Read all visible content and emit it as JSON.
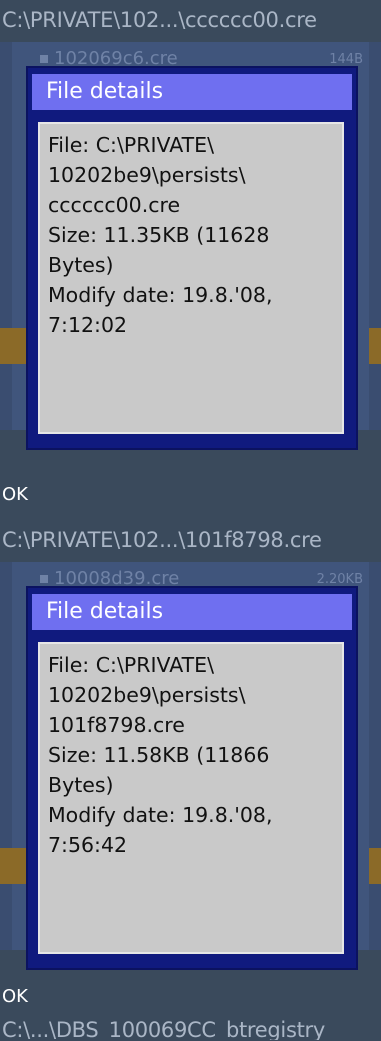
{
  "screens": [
    {
      "path": "C:\\PRIVATE\\102...\\cccccc00.cre",
      "background_file": "102069c6.cre",
      "background_size": "144B",
      "dialog": {
        "title": "File details",
        "lines": [
          "File: C:\\PRIVATE\\",
          "10202be9\\persists\\",
          "cccccc00.cre",
          "Size: 11.35KB (11628",
          "Bytes)",
          "Modify date: 19.8.'08,",
          "7:12:02"
        ]
      },
      "softkey": "OK"
    },
    {
      "path": "C:\\PRIVATE\\102...\\101f8798.cre",
      "background_file": "10008d39.cre",
      "background_size": "2.20KB",
      "dialog": {
        "title": "File details",
        "lines": [
          "File: C:\\PRIVATE\\",
          "10202be9\\persists\\",
          "101f8798.cre",
          "Size: 11.58KB (11866",
          "Bytes)",
          "Modify date: 19.8.'08,",
          "7:56:42"
        ]
      },
      "softkey": "OK"
    }
  ],
  "footer_path": "C:\\...\\DBS_100069CC_btregistry"
}
